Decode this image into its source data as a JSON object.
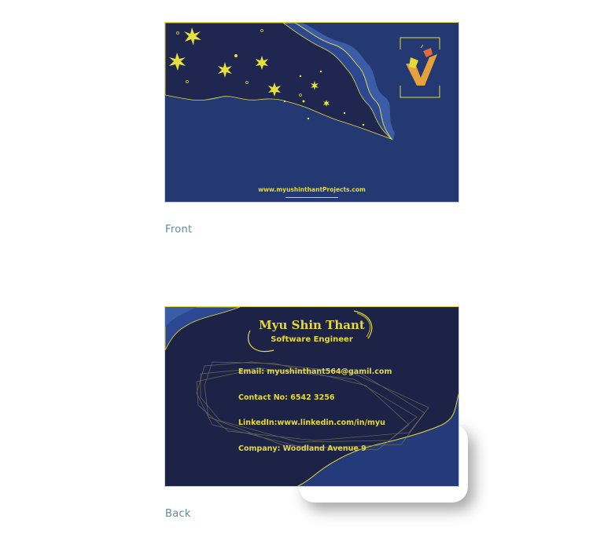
{
  "front": {
    "caption": "Front",
    "website": "www.myushinthantProjects.com"
  },
  "back": {
    "caption": "Back",
    "name": "Myu Shin Thant",
    "role": "Software Engineer",
    "email": "Email: myushinthant564@gamil.com",
    "phone": "Contact No: 6542 3256",
    "linkedin": "LinkedIn:www.linkedin.com/in/myu",
    "company": "Company: Woodland Avenue 9"
  },
  "colors": {
    "accent": "#e5d93a",
    "front_bg": "#243872",
    "back_bg": "#1d2347",
    "caption": "#5f8aa1"
  }
}
